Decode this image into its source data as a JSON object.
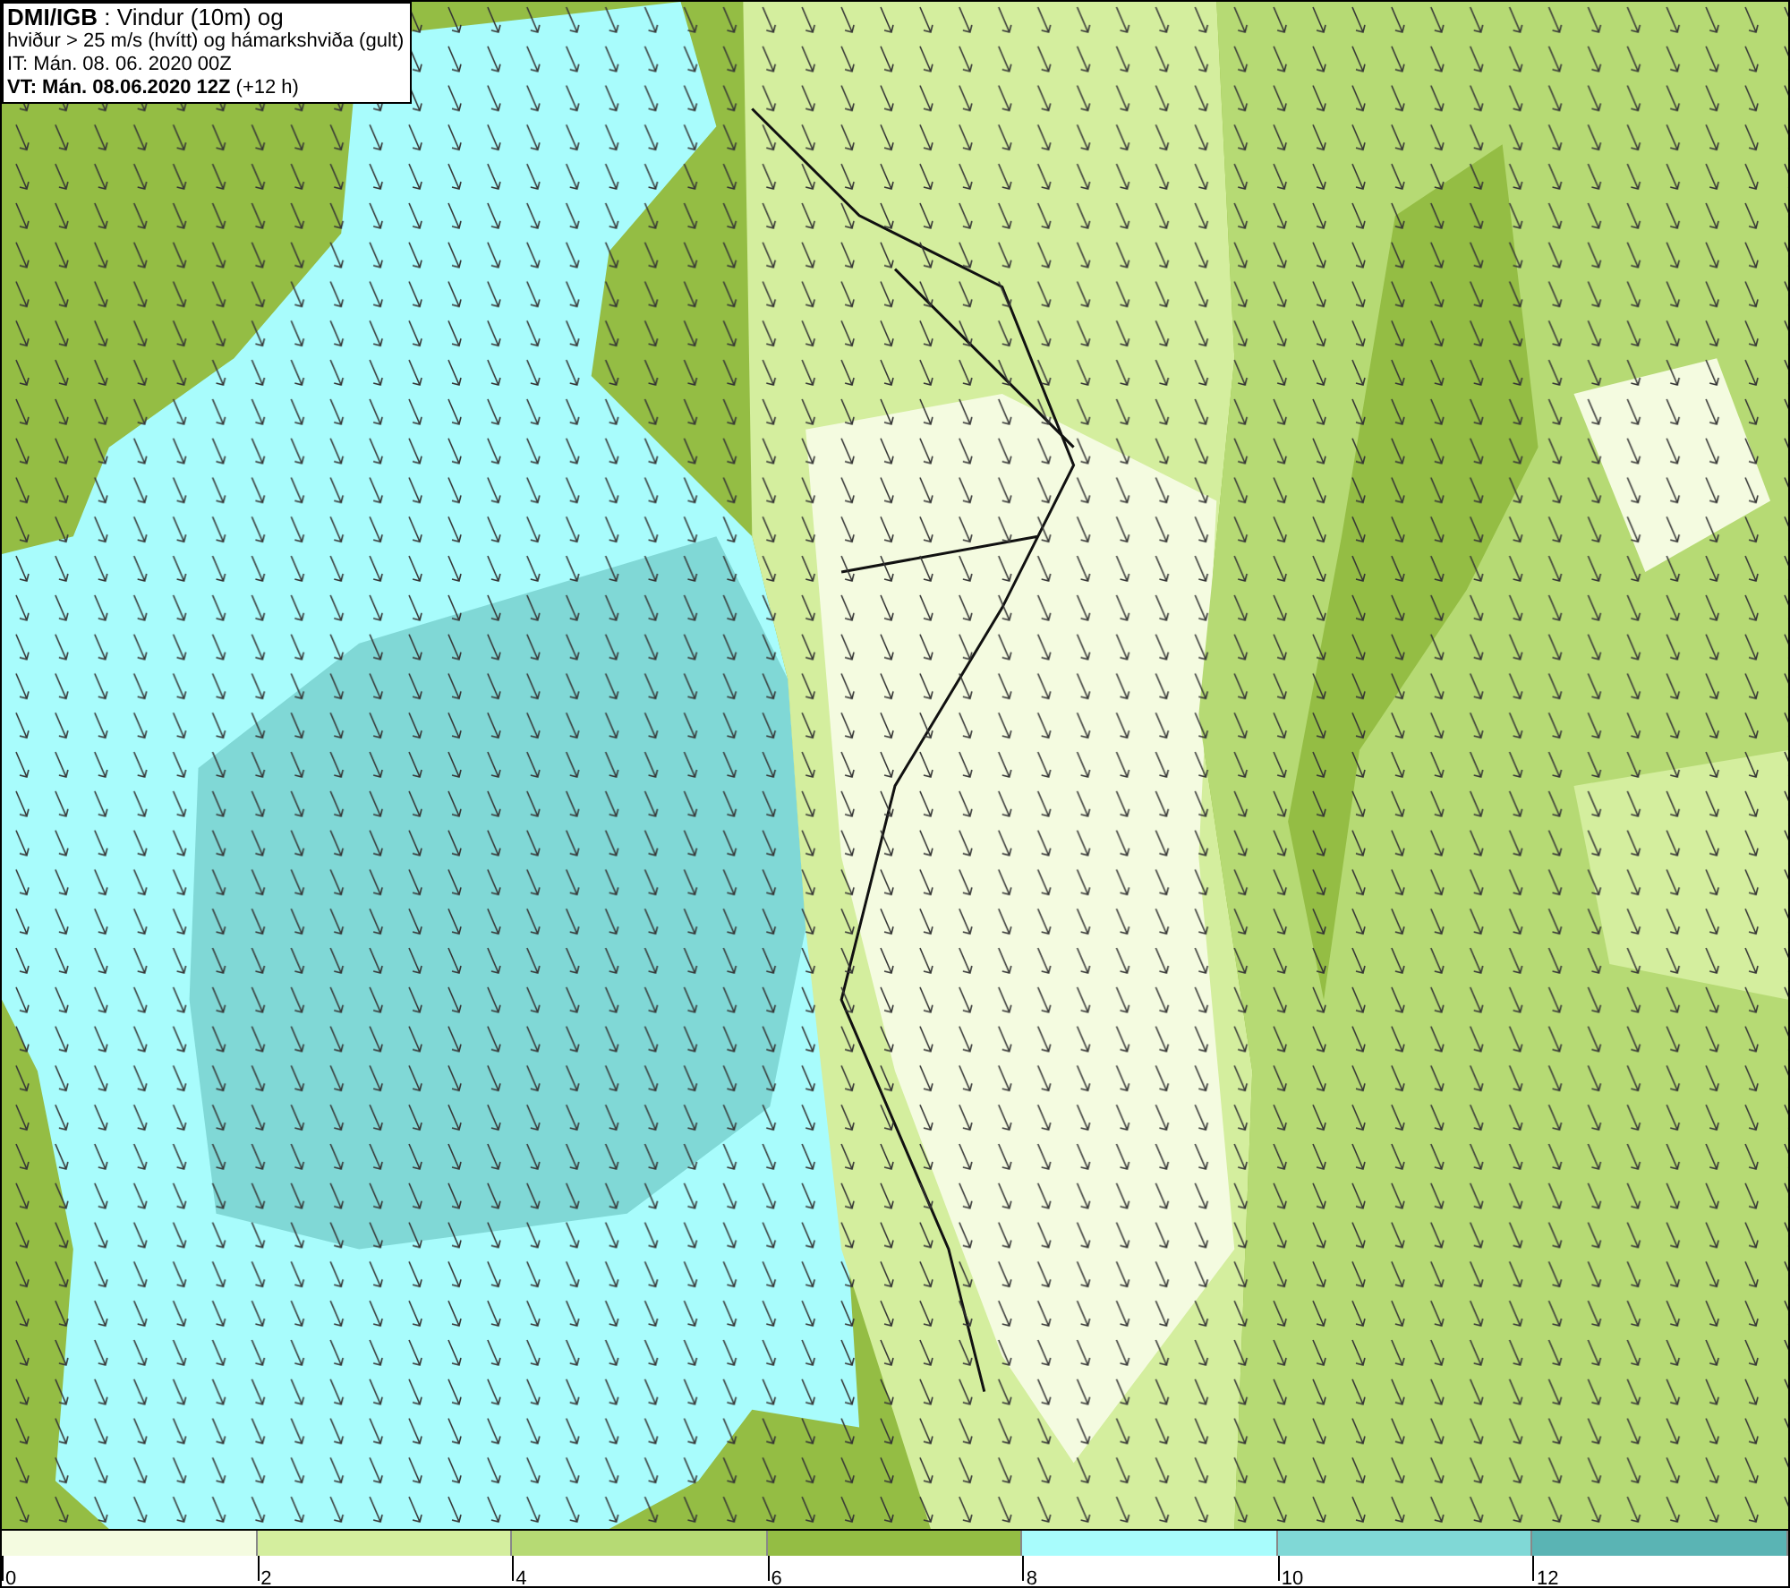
{
  "info_box": {
    "lines": [
      "**DMI/IGB** : Vindur (10m) og",
      "hviður > 25 m/s (hvítt) og hámarkshviða (gult)",
      "IT: Mán. 08. 06. 2020 00Z",
      "**VT: Mán. 08.06.2020 12Z** (+12 h)"
    ]
  },
  "legend": {
    "bins": [
      {
        "label": "0",
        "color": "#f4fbe0"
      },
      {
        "label": "2",
        "color": "#d4ee9e"
      },
      {
        "label": "4",
        "color": "#b6da74"
      },
      {
        "label": "6",
        "color": "#94bd44"
      },
      {
        "label": "8",
        "color": "#a8fcfc"
      },
      {
        "label": "10",
        "color": "#80d8d6"
      },
      {
        "label": "12",
        "color": "#5ab4b4"
      }
    ]
  }
}
